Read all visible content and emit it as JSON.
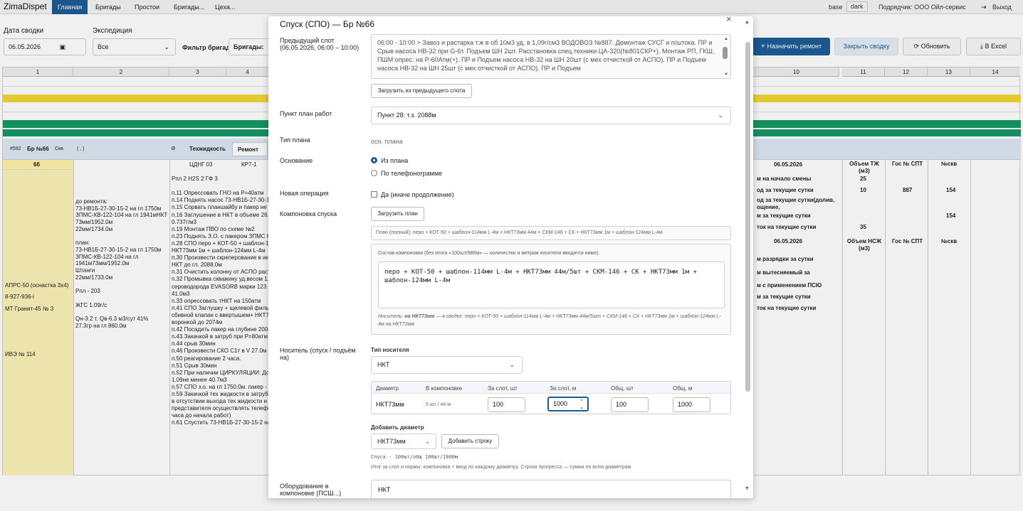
{
  "nav": {
    "brand": "ZimaDispet",
    "items": [
      "Главная",
      "Бригады",
      "Простои",
      "Бригады...",
      "Цеха..."
    ],
    "theme_base": "base",
    "theme_dark": "dark",
    "contractor": "Подрядчик: ООО Ойл-сервис",
    "logout": "Выход"
  },
  "filters": {
    "date_label": "Дата сводки",
    "date_value": "06.05.2026",
    "expedition_label": "Экспедиция",
    "expedition_value": "Все",
    "brigade_filter_label": "Фильтр бригад",
    "brigades_label": "Бригады:"
  },
  "toolbar": {
    "assign": "Назначить ремонт",
    "close": "Закрыть сводку",
    "refresh": "Обновить",
    "excel": "В Excel"
  },
  "grid": {
    "columns": [
      "1",
      "2",
      "3",
      "4",
      "10",
      "11",
      "12",
      "13",
      "14"
    ],
    "brigade_row": {
      "id": "#592",
      "name": "Бр №66",
      "well": "Скв.",
      "paren": "( , )",
      "tech_label": "Техжидкость",
      "tech_value": "Ремонт"
    },
    "header_row": {
      "brigade_num": "66",
      "tsng": "ЦДНГ 03",
      "kr": "КР7-1",
      "date": "06.05.2026",
      "vol_tzh": "Объем ТЖ (м3)",
      "gos_spt": "Гос № СПТ",
      "well_no": "№скв",
      "vol_nszh": "Объем НСЖ (м3)",
      "gos2": "Гос № СПТ",
      "well2": "№скв"
    },
    "col1": [
      "АПРС-50 (оснастка 3х4)",
      "8-927-936-i",
      "МТ Гранит-45 № 3",
      "ИВЭ № 114"
    ],
    "col2": [
      "до ремонта:",
      "73-НВ1Б-27-30-15-2 на гл 1750м",
      "ЗПМС-КВ-122-104 на гл 1941мНКТ",
      "73мм/1952.0м",
      "22мм/1734.0м",
      "",
      "план:",
      "73-НВ1Б-27-30-15-2 на гл 1750м",
      "ЗПМС-КВ-122-104 на гл",
      "1941м73мм/1952.0м",
      "Штанги",
      "22мм/1733.0м",
      "",
      "Рпл - 203",
      "",
      "ЖГС 1.09г/с",
      "",
      "Qн-3.2 т. Qв-6.3 м3/сут 41%",
      "27.3гр на гл 860.0м"
    ],
    "col3": [
      "Рпл 2 H2S 2 ГФ 3",
      "",
      "п.11 Опрессовать ГНО на Р=40атм",
      "п.14 Поднять насос 73-НВ1Б-27-30-1",
      "п.15 Сорвать планшайбу и пакер не Н",
      "п.16 Заглушение в НКТ в объеме 26.0м",
      "0.737г/м3",
      "п.19 Монтаж ПВО по схеме №2",
      "п.23 Поднять  З.О. с пакером ЗПМС Н",
      "п.28 СПО  перо + КОТ-50 + шаблон-114",
      "НКТ73мм 1м + шаблон-124мм L-4м",
      "п.30 Произвести скреперование в ин",
      "НКТ до гл. 2088.0м",
      "п.31 Очистить колонну от АСПО раст",
      "п.32 Промывка скважину уд.весом 1.",
      "сероводорода EVASORB марки 123 и",
      "41.0м3",
      "п.33 опрессовать тНКТ на 150атм",
      "п.41 СПО Заглушку + щелевой фильт",
      "сбивной клапан с ввертышем+ НКТ7",
      "воронкой до 2074м",
      "п.42 Посадить пакер на глубине 2004",
      "п.43 Закачкой в затруб при Р=80атм",
      "п.44 срыв 30мин",
      "п.46 Произвести  СКО С1т в V  27.0м",
      "п.50 реагирование 2 часа.",
      "п.51 Срыв 30мин",
      "п.52 При наличии ЦИРКУЛЯЦИИ: До",
      "1.09не менее 40.7м3",
      "п.57 СПО з.о. на гл 1750.0м. пакер - 3",
      "п.59 Закачкой тех жидкости в затрубн",
      "в отсутствии выхода тех жидкости и",
      "представителя осуществлять телефо",
      "часа до начала работ)",
      "п.61 Спустить 73-НВ1Б-27-30-15-2 на"
    ],
    "right": [
      {
        "label": "м на начало смены",
        "v1": "25",
        "v2": "",
        "v3": ""
      },
      {
        "label": "од за текущие сутки",
        "v1": "10",
        "v2": "887",
        "v3": "154"
      },
      {
        "label": "од за текущие сутки(долив,",
        "v1": "",
        "v2": "",
        "v3": ""
      },
      {
        "label": "ощение,",
        "v1": "",
        "v2": "",
        "v3": ""
      },
      {
        "label": "м за текущие сутки",
        "v1": "",
        "v2": "",
        "v3": "154"
      },
      {
        "label": "ток на текущие сутки",
        "v1": "35",
        "v2": "",
        "v3": ""
      }
    ],
    "right2": [
      "м разрядки за сутки",
      "м вытесняемый за",
      "м с применением ПСЮ",
      "м за текущие сутки",
      "ток на текущие сутки"
    ]
  },
  "modal": {
    "title": "Спуск (СПО) — Бр №66",
    "close": "×",
    "prev_slot_label": "Предыдущий слот (06.05.2026, 06:00 – 10:00)",
    "prev_slot_text": "06:00 - 10:00 > Завоз и растарка т.ж в об 10м3 уд. в 1,09г/см3 ВОДОВОЗ №887. Демонтаж СУСГ и п/штока. ПР и Срыв насоса НВ-32 при G-6т. Подъем ШН 2шт. Расстановка спец.техники ЦА-320(№801СКР+). Монтаж РП, ГКШ, ПШМ опрес. на Р-60Атм(+). ПР и Подъем насоса НВ-32 на ШН 20шт (с мех отчисткой от АСПО). ПР и Подъем насоса НВ-32 на ШН 25шт (с мех отчисткой от АСПО). ПР и Подъем",
    "load_prev_btn": "Загрузить из предыдущего слота",
    "plan_point_label": "Пункт план работ",
    "plan_point_value": "Пункт 28: т.з. 2088м",
    "plan_type_label": "Тип плана",
    "plan_type_value": "осн. плана",
    "basis_label": "Основание",
    "basis_opt1": "Из плана",
    "basis_opt2": "По телефонограмме",
    "new_op_label": "Новая операция",
    "new_op_checkbox": "Да (иначе продолжение)",
    "assembly_label": "Компоновка спуска",
    "load_plan_btn": "Загрузить план",
    "plan_full": "План (полный): перо + КОТ-50 + шаблон-114мм L-4м + НКТ73мм 44м + СКМ-146 + СК + НКТ73мм 1м + шаблон-124мм L-4м",
    "assembly_hint": "Состав компоновки (без итога «100шт/980м» — количество и метраж носителя вводятся ниже).",
    "assembly_text": "перо + КОТ-50 + шаблон-114мм L-4м + НКТ73мм 44м/5шт + СКМ-146 + СК + НКТ73мм 1м + шаблон-124мм L-4м",
    "carrier_note_label": "Носитель:",
    "carrier_note_value": "на НКТ73мм",
    "carrier_note_rest": "— в сводке: перо + КОТ-50 + шаблон-114мм L-4м + НКТ73мм 44м/5шт + СКМ-146 + СК + НКТ73мм 1м + шаблон-124мм L-4м на НКТ73мм",
    "carrier_label": "Носитель (спуск / подъём на)",
    "carrier_type_label": "Тип носителя",
    "carrier_type_value": "НКТ",
    "table_headers": [
      "Диаметр",
      "В компоновке",
      "За слот, шт",
      "За слот, м",
      "Общ, шт",
      "Общ, м"
    ],
    "table_row": {
      "diameter": "НКТ73мм",
      "in_assembly": "5 шт / 44 м",
      "slot_pcs": "100",
      "slot_m": "1000",
      "total_pcs": "100",
      "total_m": "1000"
    },
    "add_diam_label": "Добавить диаметр",
    "add_diam_value": "НКТ73мм",
    "add_row_btn": "Добавить строку",
    "summary_line": "Спуск · 100шт/общ 100шт/1000м",
    "summary_note": "Итог за слот и нормы: компоновка + ввод по каждому диаметру. Строка прогресса — сумма по всем диаметрам.",
    "equipment_label": "Оборудование в компоновке (ПСШ...)",
    "equipment_value": "НКТ"
  },
  "colors": {
    "primary": "#1d5c96",
    "yellow_band": "#f3d637",
    "green_band": "#159764",
    "col1_fill": "#fbf2b8",
    "header_fill": "#fff3a8",
    "brigade_row": "#dde8f3"
  }
}
